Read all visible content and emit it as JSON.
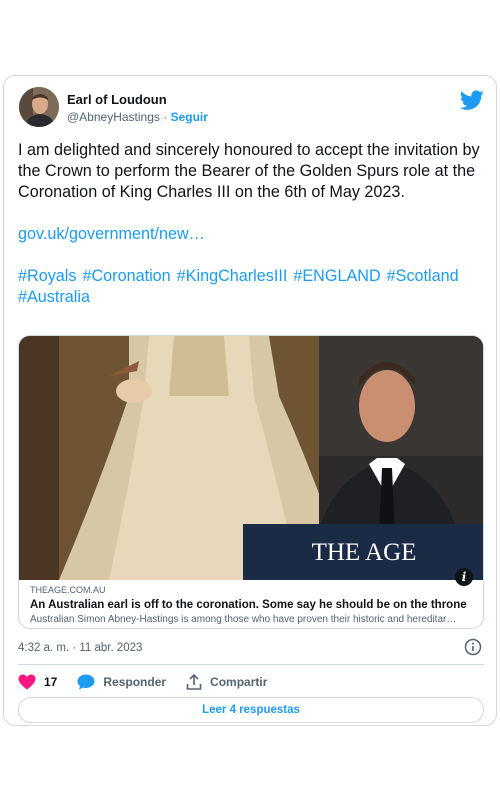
{
  "author": {
    "name": "Earl of Loudoun",
    "handle": "@AbneyHastings",
    "separator": "·",
    "follow_label": "Seguir"
  },
  "tweet": {
    "text": "I am delighted and sincerely honoured to accept the invitation by the Crown to perform the Bearer of the Golden Spurs role at the Coronation of King Charles III on the 6th of May 2023.",
    "link": "gov.uk/government/new…",
    "hashtags": [
      "#Royals",
      "#Coronation",
      "#KingCharlesIII",
      "#ENGLAND",
      "#Scotland",
      "#Australia"
    ]
  },
  "card": {
    "masthead": "THE AGE",
    "domain": "THEAGE.COM.AU",
    "title": "An Australian earl is off to the coronation. Some say he should be on the throne",
    "description": "Australian Simon Abney-Hastings is among those who have proven their historic and hereditar…",
    "info_symbol": "i"
  },
  "timestamp": "4:32 a. m. · 11 abr. 2023",
  "actions": {
    "likes": "17",
    "reply_label": "Responder",
    "share_label": "Compartir"
  },
  "read_replies_label": "Leer 4 respuestas",
  "colors": {
    "accent": "#1d9bf0",
    "like": "#f91880",
    "text": "#0f1419",
    "muted": "#536471"
  }
}
